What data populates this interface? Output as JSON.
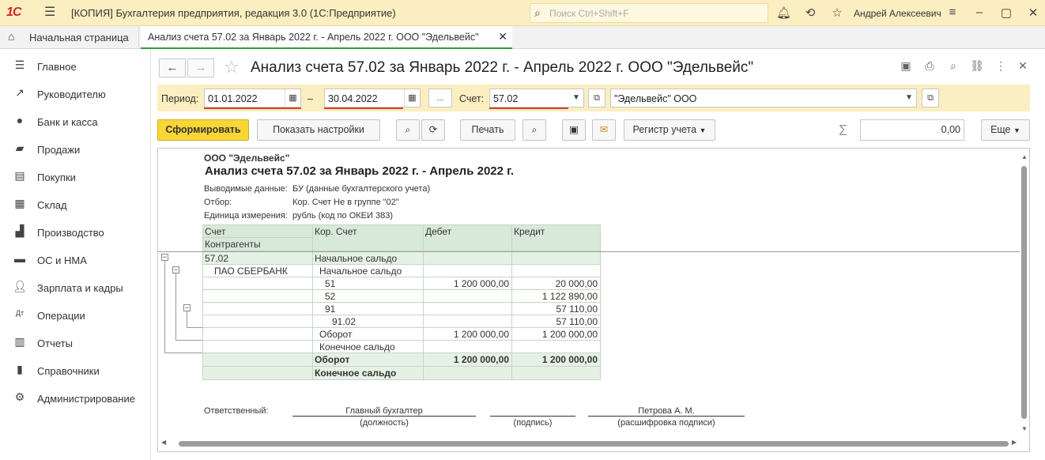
{
  "titlebar": {
    "logo": "1С",
    "title": "[КОПИЯ] Бухгалтерия предприятия, редакция 3.0  (1С:Предприятие)",
    "search_placeholder": "Поиск Ctrl+Shift+F",
    "user": "Андрей Алексеевич"
  },
  "tabs": {
    "home": "Начальная страница",
    "active": "Анализ счета 57.02 за Январь 2022 г. - Апрель 2022 г. ООО \"Эдельвейс\""
  },
  "sidebar": {
    "items": [
      {
        "label": "Главное",
        "icon": "menu-lines-icon"
      },
      {
        "label": "Руководителю",
        "icon": "trend-icon"
      },
      {
        "label": "Банк и касса",
        "icon": "coin-icon"
      },
      {
        "label": "Продажи",
        "icon": "bag-icon"
      },
      {
        "label": "Покупки",
        "icon": "cart-icon"
      },
      {
        "label": "Склад",
        "icon": "warehouse-icon"
      },
      {
        "label": "Производство",
        "icon": "factory-icon"
      },
      {
        "label": "ОС и НМА",
        "icon": "truck-icon"
      },
      {
        "label": "Зарплата и кадры",
        "icon": "person-icon"
      },
      {
        "label": "Операции",
        "icon": "dt-kt-icon"
      },
      {
        "label": "Отчеты",
        "icon": "bar-chart-icon"
      },
      {
        "label": "Справочники",
        "icon": "book-icon"
      },
      {
        "label": "Администрирование",
        "icon": "gear-icon"
      }
    ]
  },
  "form": {
    "title": "Анализ счета 57.02 за Январь 2022 г. - Апрель 2022 г. ООО \"Эдельвейс\"",
    "period_label": "Период:",
    "date_from": "01.01.2022",
    "dash": "–",
    "date_to": "30.04.2022",
    "ellipsis": "...",
    "account_label": "Счет:",
    "account": "57.02",
    "org": "\"Эдельвейс\" ООО"
  },
  "toolbar": {
    "generate": "Сформировать",
    "show_settings": "Показать настройки",
    "print": "Печать",
    "register": "Регистр учета",
    "sum_value": "0,00",
    "more": "Еще"
  },
  "report": {
    "org": "ООО \"Эдельвейс\"",
    "title": "Анализ счета 57.02 за Январь 2022 г. - Апрель 2022 г.",
    "meta": [
      {
        "label": "Выводимые данные:",
        "value": "БУ (данные бухгалтерского учета)"
      },
      {
        "label": "Отбор:",
        "value": "Кор. Счет Не в группе \"02\""
      },
      {
        "label": "Единица измерения:",
        "value": "рубль (код по ОКЕИ 383)"
      }
    ],
    "headers": {
      "account": "Счет",
      "counterparty": "Контрагенты",
      "cor_account": "Кор. Счет",
      "debit": "Дебет",
      "credit": "Кредит"
    },
    "rows": [
      {
        "c1": "57.02",
        "c2": "Начальное сальдо",
        "debit": "",
        "credit": ""
      },
      {
        "c1": "ПАО СБЕРБАНК",
        "c2": "Начальное сальдо",
        "debit": "",
        "credit": ""
      },
      {
        "c1": "",
        "c2": "51",
        "debit": "1 200 000,00",
        "credit": "20 000,00"
      },
      {
        "c1": "",
        "c2": "52",
        "debit": "",
        "credit": "1 122 890,00"
      },
      {
        "c1": "",
        "c2": "91",
        "debit": "",
        "credit": "57 110,00"
      },
      {
        "c1": "",
        "c2": "91.02",
        "debit": "",
        "credit": "57 110,00"
      },
      {
        "c1": "",
        "c2": "Оборот",
        "debit": "1 200 000,00",
        "credit": "1 200 000,00"
      },
      {
        "c1": "",
        "c2": "Конечное сальдо",
        "debit": "",
        "credit": ""
      },
      {
        "c1": "",
        "c2": "Оборот",
        "debit": "1 200 000,00",
        "credit": "1 200 000,00"
      },
      {
        "c1": "",
        "c2": "Конечное сальдо",
        "debit": "",
        "credit": ""
      }
    ],
    "signature": {
      "label": "Ответственный:",
      "position": "Главный бухгалтер",
      "position_caption": "(должность)",
      "sign_caption": "(подпись)",
      "name": "Петрова А. М.",
      "name_caption": "(расшифровка подписи)"
    }
  },
  "colors": {
    "titlebar": "#fbeec0",
    "accent_button": "#f8d637",
    "active_tab_border": "#2e9e3e",
    "required_underline": "#d8412c",
    "table_header": "#d9e9d9"
  }
}
